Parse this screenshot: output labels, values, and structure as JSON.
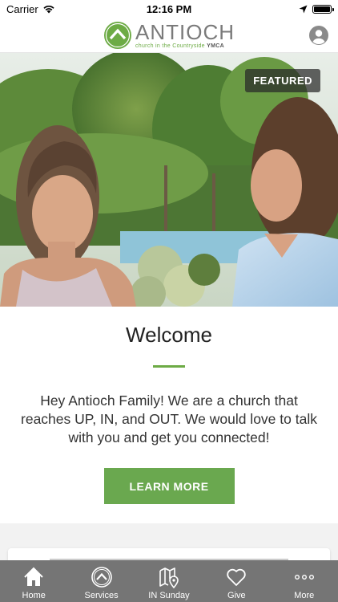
{
  "status_bar": {
    "carrier": "Carrier",
    "time": "12:16 PM"
  },
  "header": {
    "logo_name": "ANTIOCH",
    "logo_sub": "church in the Countryside",
    "logo_sub_bold": "YMCA",
    "brand_color": "#6dab45"
  },
  "hero": {
    "badge": "FEATURED"
  },
  "welcome": {
    "title": "Welcome",
    "body": "Hey Antioch Family! We are a church that reaches UP, IN, and OUT. We would love to talk with you and get you connected!",
    "button": "LEARN MORE"
  },
  "tabs": [
    {
      "label": "Home",
      "icon": "home-icon"
    },
    {
      "label": "Services",
      "icon": "services-icon"
    },
    {
      "label": "IN Sunday",
      "icon": "map-icon"
    },
    {
      "label": "Give",
      "icon": "heart-icon"
    },
    {
      "label": "More",
      "icon": "more-icon"
    }
  ]
}
